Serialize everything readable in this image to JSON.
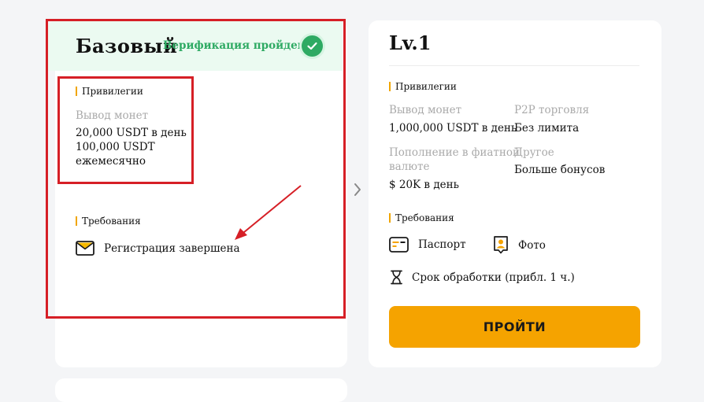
{
  "basic": {
    "title": "Базовый",
    "verified_text": "Верификация пройдена",
    "privileges_label": "Привилегии",
    "withdraw_label": "Вывод монет",
    "withdraw_daily": "20,000 USDT в день",
    "withdraw_monthly_1": "100,000 USDT",
    "withdraw_monthly_2": "ежемесячно",
    "requirements_label": "Требования",
    "requirement_item": "Регистрация завершена"
  },
  "lv1": {
    "title": "Lv.1",
    "privileges_label": "Привилегии",
    "withdraw_label": "Вывод монет",
    "withdraw_value": "1,000,000 USDT в день",
    "p2p_label": "P2P торговля",
    "p2p_value": "Без лимита",
    "fiat_label_1": "Пополнение в фиатной",
    "fiat_label_2": "валюте",
    "fiat_value": "$ 20K в день",
    "other_label": "Другое",
    "other_value": "Больше бонусов",
    "requirements_label": "Требования",
    "passport_label": "Паспорт",
    "photo_label": "Фото",
    "processing_label": "Срок обработки (прибл. 1 ч.)",
    "go_button": "ПРОЙТИ"
  },
  "colors": {
    "accent": "#f5a300",
    "verified": "#2eaa63",
    "highlight": "#d61f26"
  },
  "icons": {
    "check": "check-icon",
    "envelope": "envelope-icon",
    "chevron": "chevron-right-icon",
    "passport": "id-card-icon",
    "photo": "portrait-photo-icon",
    "hourglass": "hourglass-icon"
  }
}
